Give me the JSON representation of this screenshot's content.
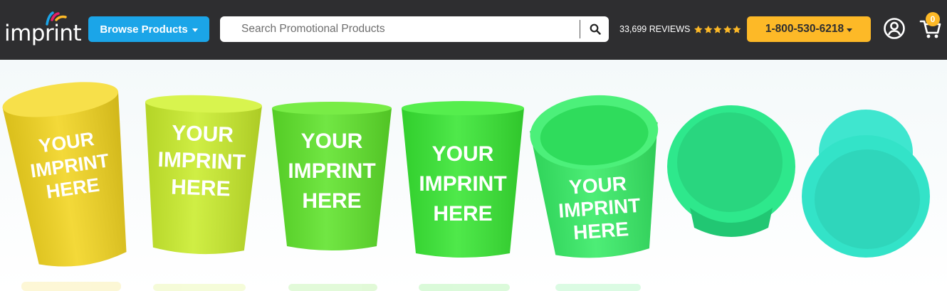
{
  "header": {
    "logo_alt": "imprint",
    "logo_text": "imprint",
    "browse_label": "Browse Products",
    "search_placeholder": "Search Promotional Products",
    "reviews_text": "33,699 REVIEWS",
    "rating_stars": 5,
    "phone_label": "1-800-530-6218",
    "cart_count": "0",
    "colors": {
      "bar": "#2e2e30",
      "browse": "#1ba5e8",
      "phone": "#fdb927"
    },
    "icons": [
      "search-icon",
      "star-icon",
      "user-icon",
      "cart-icon"
    ]
  },
  "hero": {
    "cup_imprint_lines": [
      "YOUR",
      "IMPRINT",
      "HERE"
    ],
    "cup_colors": [
      "#f2d41e",
      "#c9ec2b",
      "#5ee32a",
      "#37e632",
      "#35eb64",
      "#2ee88c",
      "#33e3c8"
    ]
  }
}
